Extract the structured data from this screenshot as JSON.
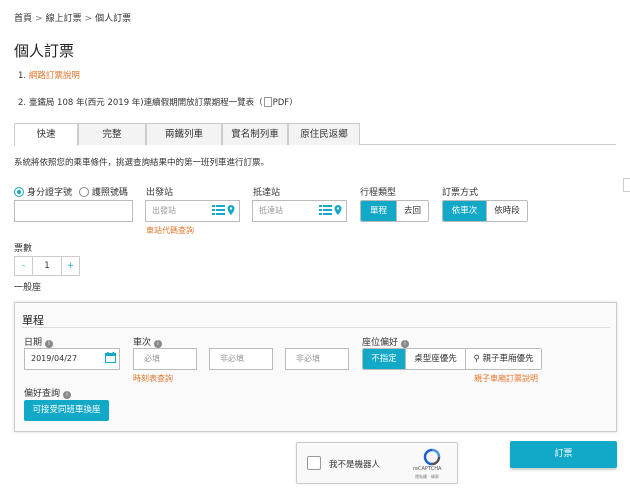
{
  "breadcrumb": {
    "items": [
      "首頁",
      "線上訂票",
      "個人訂票"
    ],
    "separator": ">"
  },
  "page_title": "個人訂票",
  "notes": {
    "n1_prefix": "1.",
    "n1_link": "網路訂票說明",
    "n2_prefix": "2.",
    "n2_text": "臺鐵局 108 年(西元 2019 年)連續假期開放訂票期程一覽表（",
    "n2_pdf": "PDF",
    "n2_close": "）"
  },
  "tabs": [
    {
      "label": "快速",
      "active": true
    },
    {
      "label": "完整",
      "active": false
    },
    {
      "label": "兩鐵列車",
      "active": false
    },
    {
      "label": "實名制列車",
      "active": false
    },
    {
      "label": "原住民返鄉",
      "active": false
    }
  ],
  "instruction": "系統將依照您的乘車條件，挑選查詢結果中的第一班列車進行訂票。",
  "id_type": {
    "options": [
      {
        "label": "身分證字號",
        "selected": true
      },
      {
        "label": "護照號碼",
        "selected": false
      }
    ],
    "value": ""
  },
  "from_station": {
    "label": "出發站",
    "placeholder": "出發站",
    "code_link": "車站代碼查詢"
  },
  "to_station": {
    "label": "抵達站",
    "placeholder": "抵達站"
  },
  "trip_type": {
    "label": "行程類型",
    "options": [
      "單程",
      "去回"
    ],
    "selected": "單程"
  },
  "order_method": {
    "label": "訂票方式",
    "options": [
      "依車次",
      "依時段"
    ],
    "selected": "依車次"
  },
  "tickets": {
    "label": "票數",
    "minus": "-",
    "value": "1",
    "plus": "+",
    "type_label": "一般座"
  },
  "panel": {
    "title": "單程",
    "date_label": "日期",
    "date_value": "2019/04/27",
    "train_label": "車次",
    "train_inputs": [
      "必填",
      "非必填",
      "非必填"
    ],
    "timetable_link": "時刻表查詢",
    "seat_label": "座位偏好",
    "seat_options": [
      "不指定",
      "桌型座優先",
      "親子車廂優先"
    ],
    "seat_selected": "不指定",
    "family_link": "親子車廂訂票說明",
    "pref_label": "偏好查詢",
    "pref_button": "可接受同班車換座"
  },
  "recaptcha": {
    "label": "我不是機器人",
    "brand": "reCAPTCHA",
    "terms": "隱私權 - 條款"
  },
  "submit_label": "訂票",
  "colors": {
    "accent": "#12a8c8",
    "link": "#e5762a"
  }
}
